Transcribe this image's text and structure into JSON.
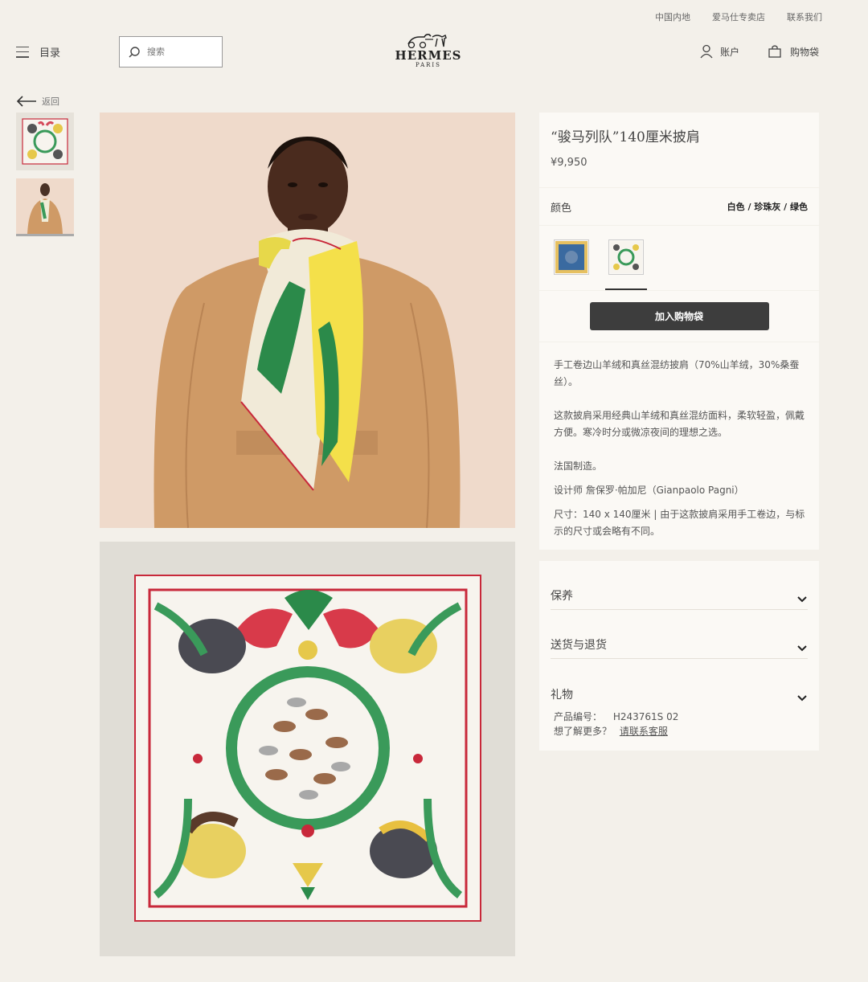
{
  "topbar": {
    "links": [
      "中国内地",
      "爱马仕专卖店",
      "联系我们"
    ]
  },
  "header": {
    "menu_label": "目录",
    "search_placeholder": "搜索",
    "logo_name": "HERMES",
    "logo_sub": "PARIS",
    "account_label": "账户",
    "bag_label": "购物袋"
  },
  "back_label": "返回",
  "product": {
    "title": "“骏马列队”140厘米披肩",
    "price": "¥9,950",
    "color_label": "颜色",
    "color_value": "白色 / 珍珠灰 / 绿色",
    "add_to_bag": "加入购物袋",
    "description": [
      "手工卷边山羊绒和真丝混纺披肩（70%山羊绒，30%桑蚕丝）。",
      "这款披肩采用经典山羊绒和真丝混纺面料，柔软轻盈，佩戴方便。寒冷时分或微凉夜间的理想之选。",
      "法国制造。",
      "设计师 詹保罗·帕加尼（Gianpaolo Pagni）",
      "尺寸：140 x 140厘米 | 由于这款披肩采用手工卷边，与标示的尺寸或会略有不同。"
    ],
    "accordion": [
      "保养",
      "送货与退货",
      "礼物"
    ],
    "ref_label": "产品编号：",
    "ref_value": "H243761S 02",
    "help_text": "想了解更多？",
    "help_link": "请联系客服"
  },
  "colors": {
    "accent": "#3d3d3d",
    "background": "#f3f0ea",
    "panel": "#fbf9f5"
  }
}
